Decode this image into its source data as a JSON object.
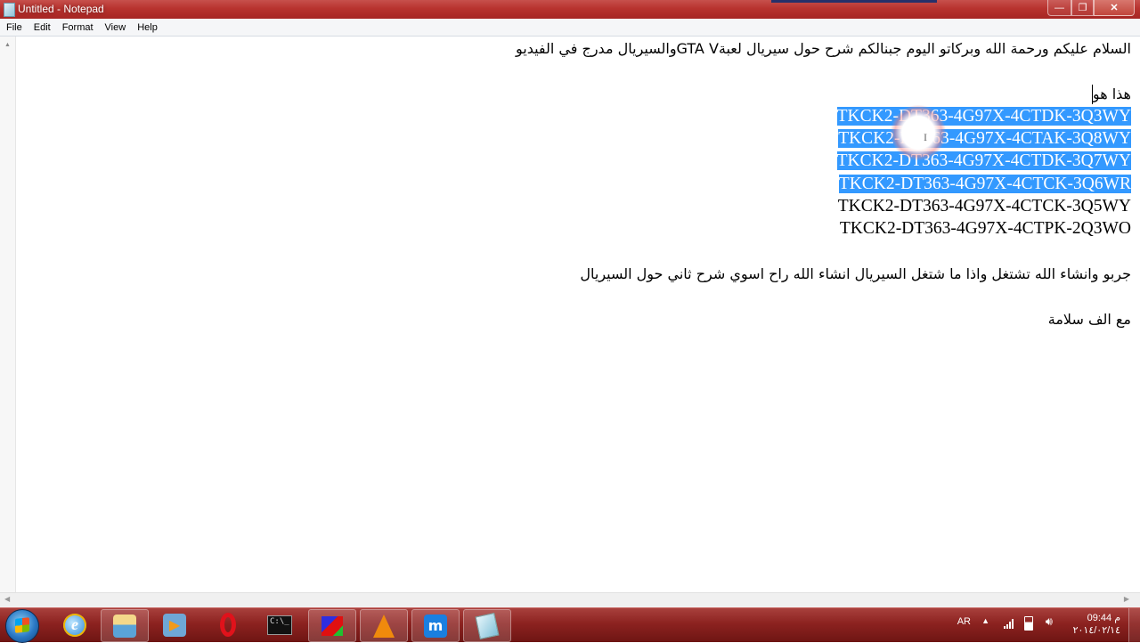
{
  "window": {
    "title": "Untitled - Notepad",
    "controls": {
      "minimize": "—",
      "maximize": "❐",
      "close": "✕"
    }
  },
  "menu": [
    "File",
    "Edit",
    "Format",
    "View",
    "Help"
  ],
  "document": {
    "lines": [
      {
        "text": "السلام عليكم ورحمة الله وبركاتو اليوم جبنالكم شرح حول سيريال لعبةGTA Vوالسيريال مدرج في الفيديو",
        "lang": "ar",
        "selected": false
      },
      {
        "text": "",
        "selected": false
      },
      {
        "text": "هذا هو",
        "lang": "ar",
        "selected": false,
        "caret": true
      },
      {
        "text": "TKCK2-DT363-4G97X-4CTDK-3Q3WY",
        "selected": true
      },
      {
        "text": "TKCK2-DT363-4G97X-4CTAK-3Q8WY",
        "selected": true
      },
      {
        "text": "TKCK2-DT363-4G97X-4CTDK-3Q7WY",
        "selected": true
      },
      {
        "text": "TKCK2-DT363-4G97X-4CTCK-3Q6WR",
        "selected": true
      },
      {
        "text": "TKCK2-DT363-4G97X-4CTCK-3Q5WY",
        "selected": false
      },
      {
        "text": "TKCK2-DT363-4G97X-4CTPK-2Q3WO",
        "selected": false
      },
      {
        "text": "",
        "selected": false
      },
      {
        "text": "جربو وانشاء الله تشتغل واذا ما شتغل السيريال انشاء الله راح اسوي شرح ثاني حول السيريال",
        "lang": "ar",
        "selected": false
      },
      {
        "text": "",
        "selected": false
      },
      {
        "text": "مع الف سلامة",
        "lang": "ar",
        "selected": false
      }
    ],
    "selection_color": "#3399ff"
  },
  "taskbar": {
    "items": [
      {
        "name": "internet-explorer",
        "active": false
      },
      {
        "name": "windows-explorer",
        "active": true
      },
      {
        "name": "media-player",
        "active": false
      },
      {
        "name": "opera",
        "active": false
      },
      {
        "name": "command-prompt",
        "active": false,
        "label": "C:\\_"
      },
      {
        "name": "3d-cube-app",
        "active": true
      },
      {
        "name": "vlc",
        "active": true
      },
      {
        "name": "maxthon",
        "active": true
      },
      {
        "name": "notepad",
        "active": true
      }
    ],
    "tray": {
      "language": "AR",
      "time": "09:44 م",
      "date": "٢٠١٤/٠٢/١٤"
    }
  },
  "colors": {
    "titlebar": "#b8332f",
    "taskbar": "#8c2220",
    "selection": "#3399ff"
  }
}
